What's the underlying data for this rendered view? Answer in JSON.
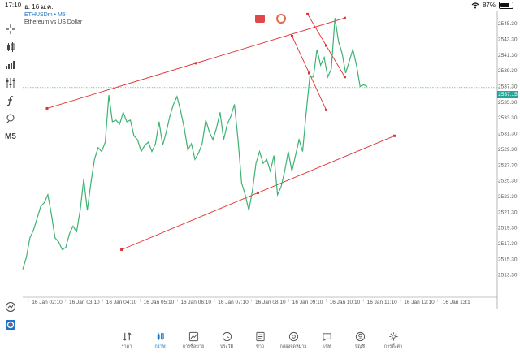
{
  "status_bar": {
    "time": "17:10",
    "date": "อ. 16 ม.ค.",
    "battery": "87%"
  },
  "symbol": {
    "title": "ETHUSDm • M5",
    "description": "Ethereum vs US Dollar"
  },
  "toolbar": {
    "timeframe": "M5"
  },
  "price_tag": "2537.15",
  "colors": {
    "line": "#3cb371",
    "trend": "#e03030",
    "accent": "#1a73c5",
    "price_tag": "#26a69a"
  },
  "chart_data": {
    "type": "line",
    "y_ticks": [
      "2545.30",
      "2543.30",
      "2541.30",
      "2539.30",
      "2537.30",
      "2535.30",
      "2533.30",
      "2531.30",
      "2529.30",
      "2527.30",
      "2525.30",
      "2523.30",
      "2521.30",
      "2519.30",
      "2517.30",
      "2515.30",
      "2513.30"
    ],
    "x_ticks": [
      "16 Jan 02:10",
      "16 Jan 03:10",
      "16 Jan 04:10",
      "16 Jan 05:10",
      "16 Jan 06:10",
      "16 Jan 07:10",
      "16 Jan 08:10",
      "16 Jan 09:10",
      "16 Jan 10:10",
      "16 Jan 11:10",
      "16 Jan 12:10",
      "16 Jan 13:1"
    ],
    "ylim": [
      2512.5,
      2546.5
    ],
    "series": [
      {
        "values": [
          2514.0,
          2515.5,
          2518.0,
          2519.0,
          2520.5,
          2522.0,
          2522.5,
          2523.5,
          2521.0,
          2518.0,
          2517.5,
          2516.5,
          2516.8,
          2518.5,
          2519.5,
          2518.8,
          2521.5,
          2525.5,
          2521.5,
          2525.0,
          2528.0,
          2529.5,
          2529.0,
          2530.2,
          2536.2,
          2532.8,
          2533.0,
          2532.5,
          2534.0,
          2532.8,
          2533.0,
          2531.0,
          2530.5,
          2529.0,
          2529.8,
          2530.2,
          2529.0,
          2530.0,
          2532.8,
          2529.8,
          2531.5,
          2533.5,
          2535.0,
          2536.0,
          2534.2,
          2532.0,
          2529.2,
          2530.0,
          2528.0,
          2528.8,
          2530.0,
          2533.0,
          2531.5,
          2530.5,
          2532.0,
          2534.0,
          2530.5,
          2532.5,
          2533.5,
          2535.0,
          2530.5,
          2525.0,
          2523.5,
          2521.5,
          2524.0,
          2527.5,
          2529.0,
          2527.5,
          2528.0,
          2526.5,
          2528.5,
          2523.5,
          2524.5,
          2526.5,
          2529.0,
          2526.5,
          2528.5,
          2530.5,
          2529.0,
          2534.0,
          2538.5,
          2538.5,
          2542.0,
          2540.0,
          2541.0,
          2538.5,
          2539.5,
          2546.0,
          2543.0,
          2541.5,
          2539.0,
          2540.5,
          2542.0,
          2540.0,
          2537.3,
          2537.5,
          2537.3
        ]
      }
    ],
    "trendlines": [
      {
        "from": {
          "x": "16 Jan 02:10",
          "y": 2534.5
        },
        "to": {
          "x": "16 Jan 10:10",
          "y": 2546.0
        }
      },
      {
        "from": {
          "x": "16 Jan 04:10",
          "y": 2516.5
        },
        "to": {
          "x": "16 Jan 11:30",
          "y": 2531.0
        }
      },
      {
        "from": {
          "x": "16 Jan 09:10",
          "y": 2546.5
        },
        "to": {
          "x": "16 Jan 10:10",
          "y": 2538.5
        }
      },
      {
        "from": {
          "x": "16 Jan 08:45",
          "y": 2543.7
        },
        "to": {
          "x": "16 Jan 09:40",
          "y": 2534.3
        }
      }
    ]
  },
  "bottom_nav": [
    {
      "label": "ราคา",
      "icon": "quotes-icon",
      "active": false
    },
    {
      "label": "กราฟ",
      "icon": "chart-icon",
      "active": true
    },
    {
      "label": "การซื้อขาย",
      "icon": "trade-icon",
      "active": false
    },
    {
      "label": "ประวัติ",
      "icon": "history-icon",
      "active": false
    },
    {
      "label": "ข่าว",
      "icon": "news-icon",
      "active": false
    },
    {
      "label": "กล่องจดหมาย",
      "icon": "mailbox-icon",
      "active": false
    },
    {
      "label": "แชท",
      "icon": "chat-icon",
      "active": false
    },
    {
      "label": "บัญชี",
      "icon": "account-icon",
      "active": false
    },
    {
      "label": "การตั้งค่า",
      "icon": "settings-icon",
      "active": false
    }
  ]
}
